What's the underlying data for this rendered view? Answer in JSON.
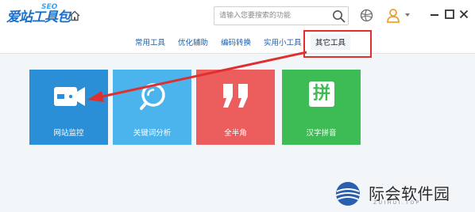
{
  "app": {
    "logo_text": "爱站工具包",
    "logo_tag": "SEO"
  },
  "search": {
    "placeholder": "请输入您要搜索的功能"
  },
  "nav": {
    "items": [
      {
        "label": "常用工具"
      },
      {
        "label": "优化辅助"
      },
      {
        "label": "编码转换"
      },
      {
        "label": "实用小工具"
      },
      {
        "label": "其它工具",
        "active": true
      }
    ]
  },
  "tiles": [
    {
      "label": "网站监控",
      "color": "#2a8fd6",
      "icon": "camera-icon"
    },
    {
      "label": "关键词分析",
      "color": "#4bb4ec",
      "icon": "magnifier-icon"
    },
    {
      "label": "全半角",
      "color": "#ec5d5d",
      "icon": "quote-icon"
    },
    {
      "label": "汉字拼音",
      "color": "#3dbb54",
      "icon": "pinyin-icon",
      "glyph": "拼"
    }
  ],
  "annotation": {
    "color": "#e02f2f"
  },
  "watermark": {
    "text": "际会软件园",
    "sub": "ZUIHUI.TOP"
  }
}
